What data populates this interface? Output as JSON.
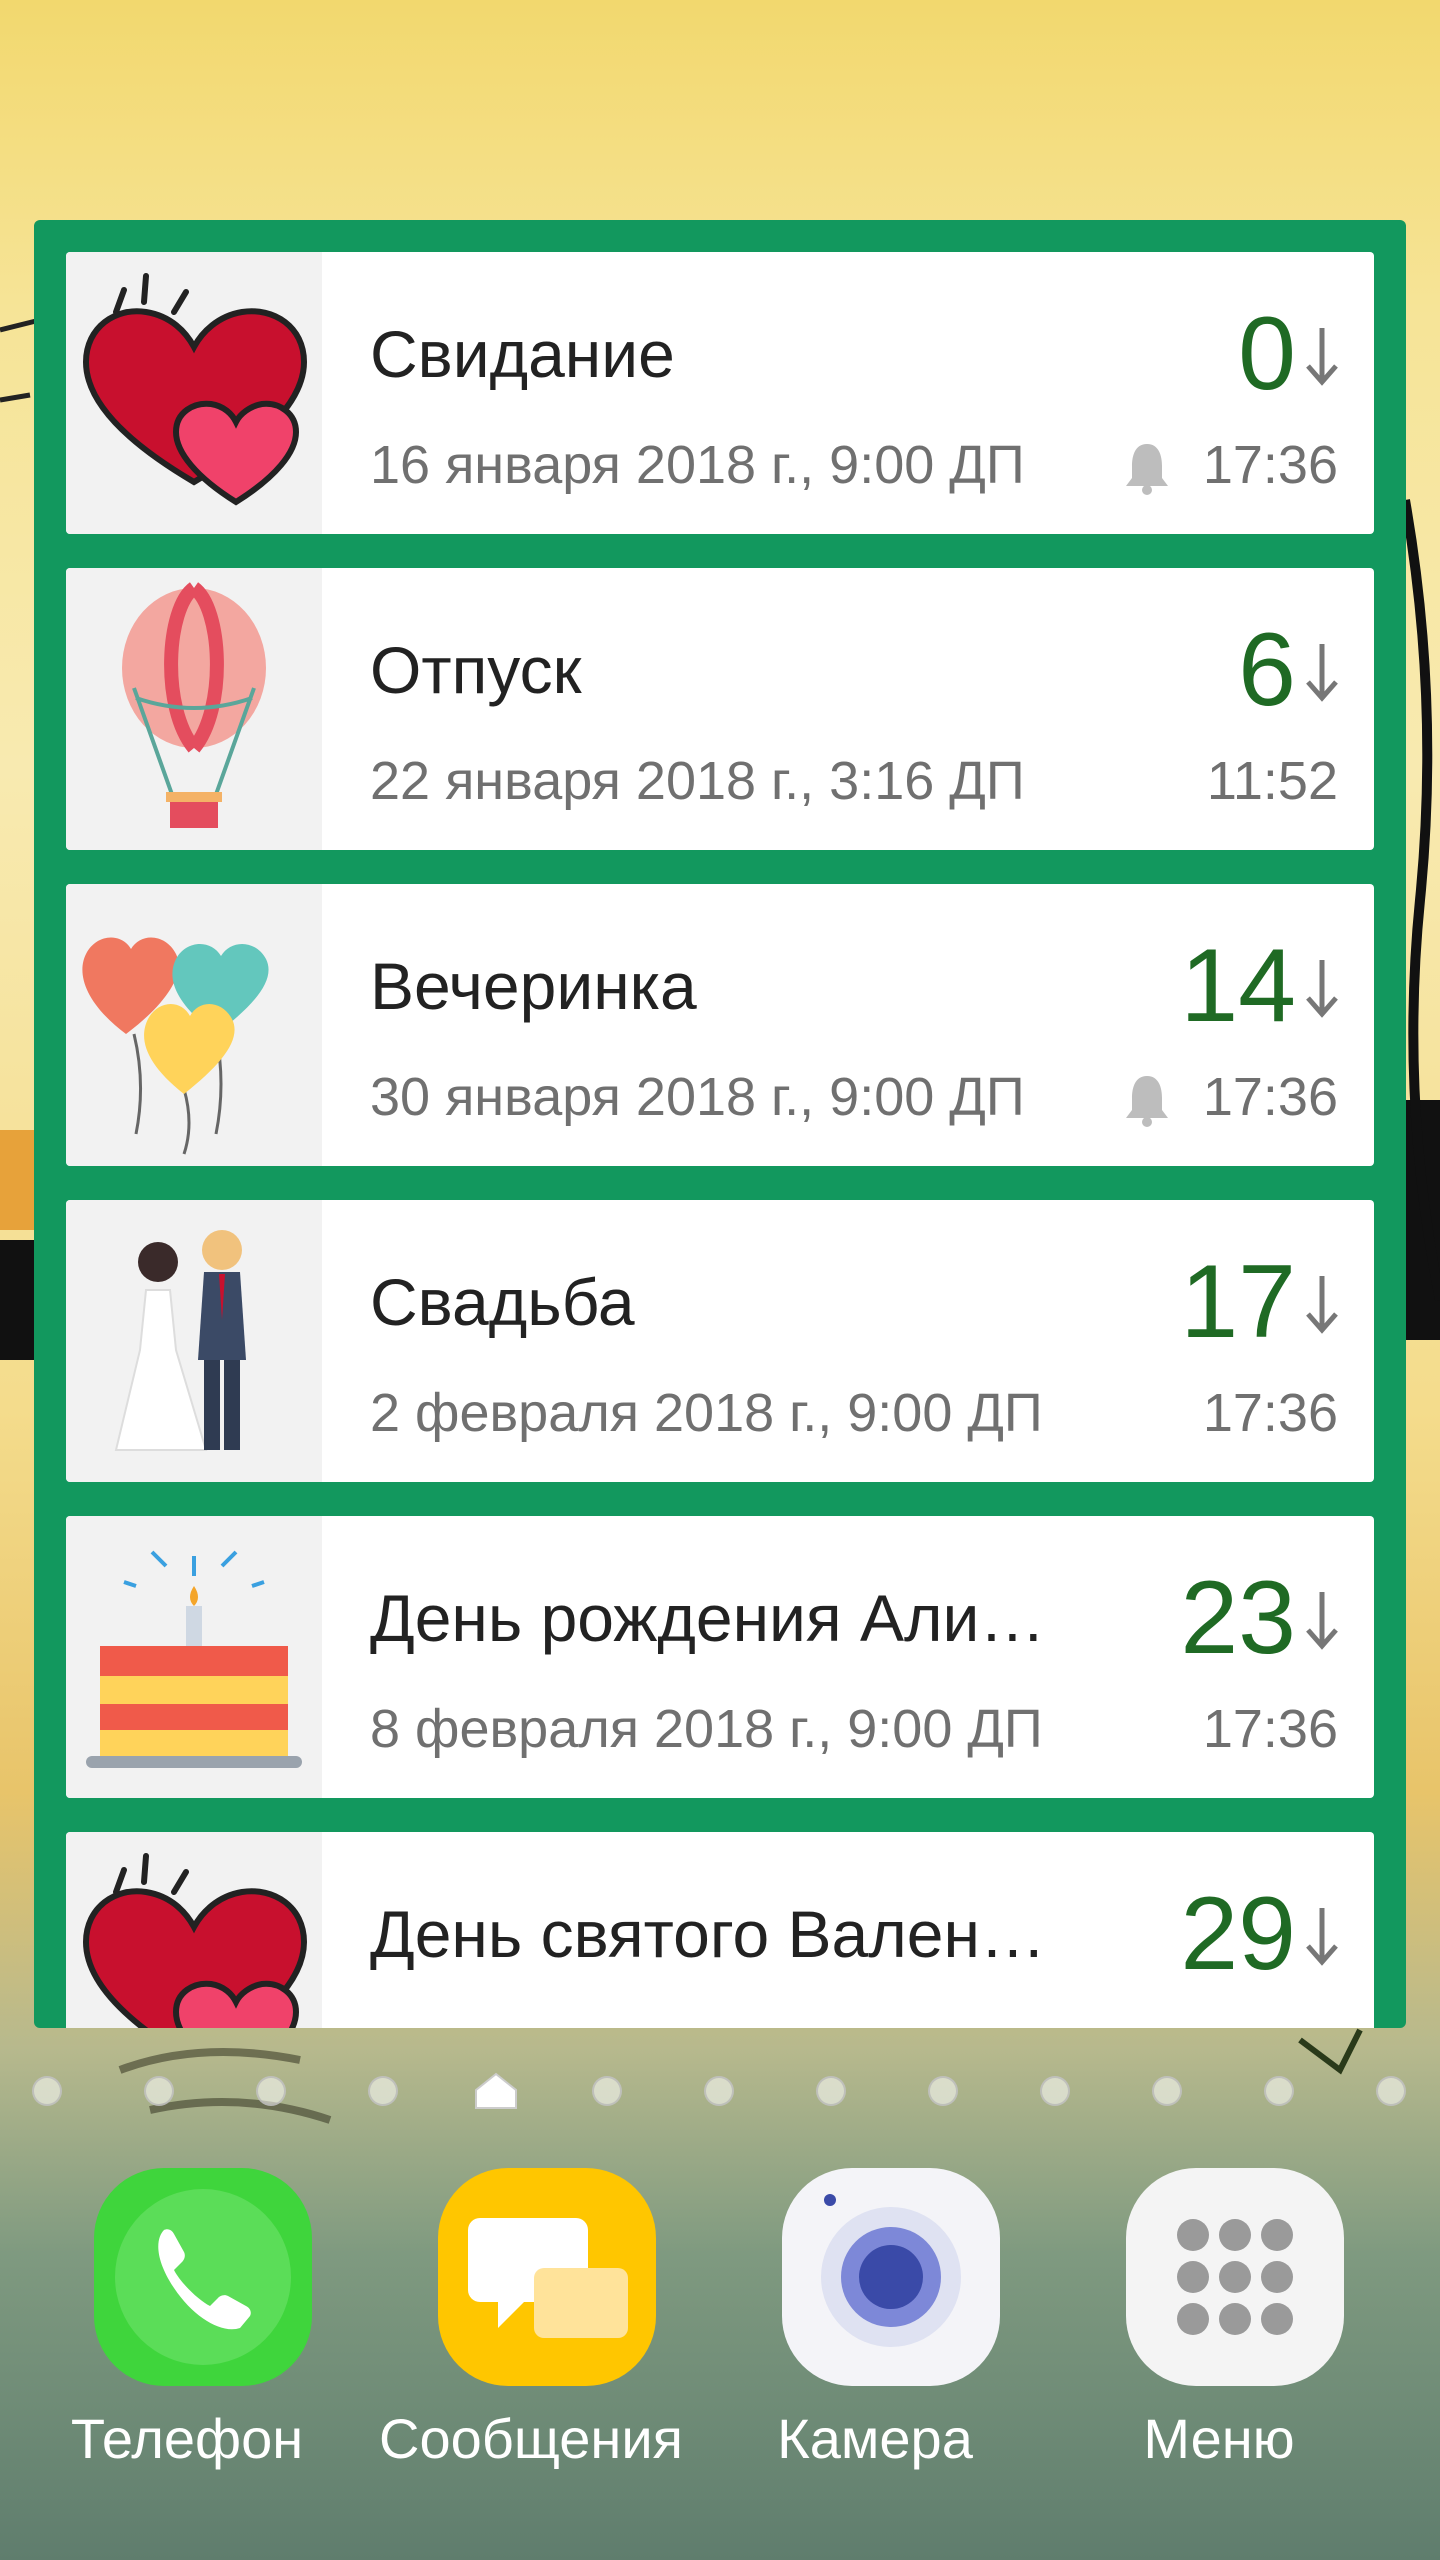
{
  "events": [
    {
      "title": "Свидание",
      "date": "16 января 2018 г., 9:00 ДП",
      "count": "0",
      "time": "17:36",
      "has_alarm": true,
      "icon": "hearts-icon"
    },
    {
      "title": "Отпуск",
      "date": "22 января 2018 г., 3:16 ДП",
      "count": "6",
      "time": "11:52",
      "has_alarm": false,
      "icon": "hot-air-balloon-icon"
    },
    {
      "title": "Вечеринка",
      "date": "30 января 2018 г., 9:00 ДП",
      "count": "14",
      "time": "17:36",
      "has_alarm": true,
      "icon": "balloons-icon"
    },
    {
      "title": "Свадьба",
      "date": "2 февраля 2018 г., 9:00 ДП",
      "count": "17",
      "time": "17:36",
      "has_alarm": false,
      "icon": "wedding-couple-icon"
    },
    {
      "title": "День рождения Али…",
      "date": "8 февраля 2018 г., 9:00 ДП",
      "count": "23",
      "time": "17:36",
      "has_alarm": false,
      "icon": "birthday-cake-icon"
    },
    {
      "title": "День святого Вален…",
      "date": "",
      "count": "29",
      "time": "",
      "has_alarm": true,
      "icon": "hearts-icon"
    }
  ],
  "dock": [
    {
      "label": "Телефон",
      "icon": "phone-icon",
      "color": "#3fd53c"
    },
    {
      "label": "Сообщения",
      "icon": "messages-icon",
      "color": "#ffc600"
    },
    {
      "label": "Камера",
      "icon": "camera-icon",
      "color": "#f4f4f8"
    },
    {
      "label": "Меню",
      "icon": "apps-grid-icon",
      "color": "#f4f4f4"
    }
  ],
  "colors": {
    "widget_bg": "#12985e",
    "count": "#1f6a24"
  }
}
